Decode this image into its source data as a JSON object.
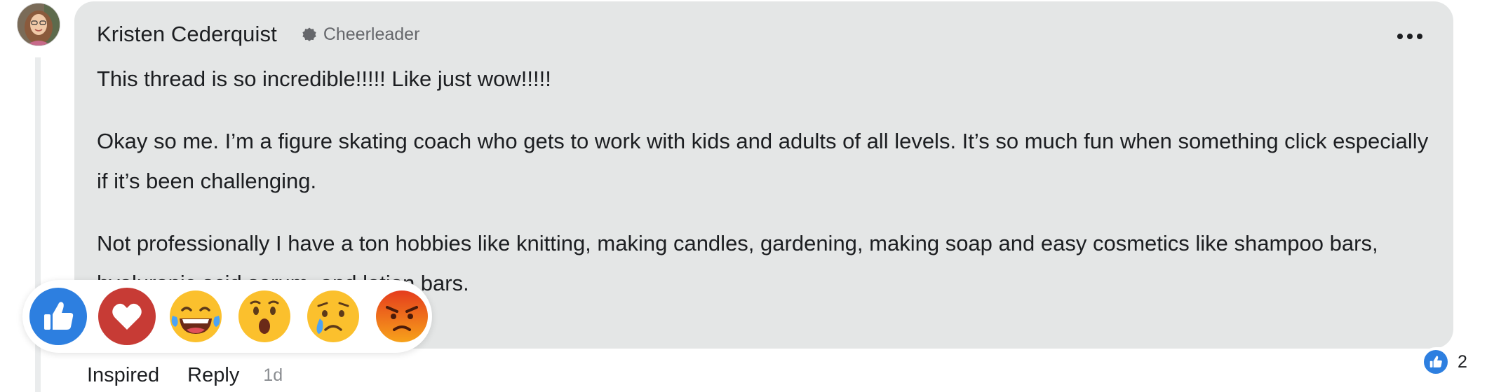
{
  "comment": {
    "author": "Kristen Cederquist",
    "badge": "Cheerleader",
    "badge_icon": "badge-icon",
    "more_icon": "more-options-icon",
    "paragraphs": [
      "This thread is so incredible!!!!! Like just wow!!!!!",
      "Okay so me. I’m a figure skating coach who gets to work with kids and adults of all levels. It’s so much fun when something click especially if it’s been challenging.",
      "Not professionally I have a ton hobbies like knitting, making candles, gardening, making soap and easy cosmetics like shampoo bars, hyaluronic acid serum, and lotion bars."
    ]
  },
  "reaction_picker": {
    "reactions": [
      {
        "name": "like",
        "icon": "thumbs-up-icon",
        "color": "#2d7fe0"
      },
      {
        "name": "love",
        "icon": "heart-icon",
        "color": "#c73b35"
      },
      {
        "name": "haha",
        "icon": "laughing-face-icon"
      },
      {
        "name": "wow",
        "icon": "surprised-face-icon"
      },
      {
        "name": "sad",
        "icon": "crying-face-icon"
      },
      {
        "name": "angry",
        "icon": "angry-face-icon"
      }
    ]
  },
  "actions": {
    "reaction_label": "Inspired",
    "reply_label": "Reply",
    "timestamp": "1d"
  },
  "reaction_summary": {
    "icon": "thumbs-up-icon",
    "count": "2"
  },
  "colors": {
    "bubble": "#e4e6e6",
    "text": "#1c1e21",
    "muted": "#65676b",
    "like_blue": "#2d7fe0",
    "love_red": "#c73b35"
  }
}
